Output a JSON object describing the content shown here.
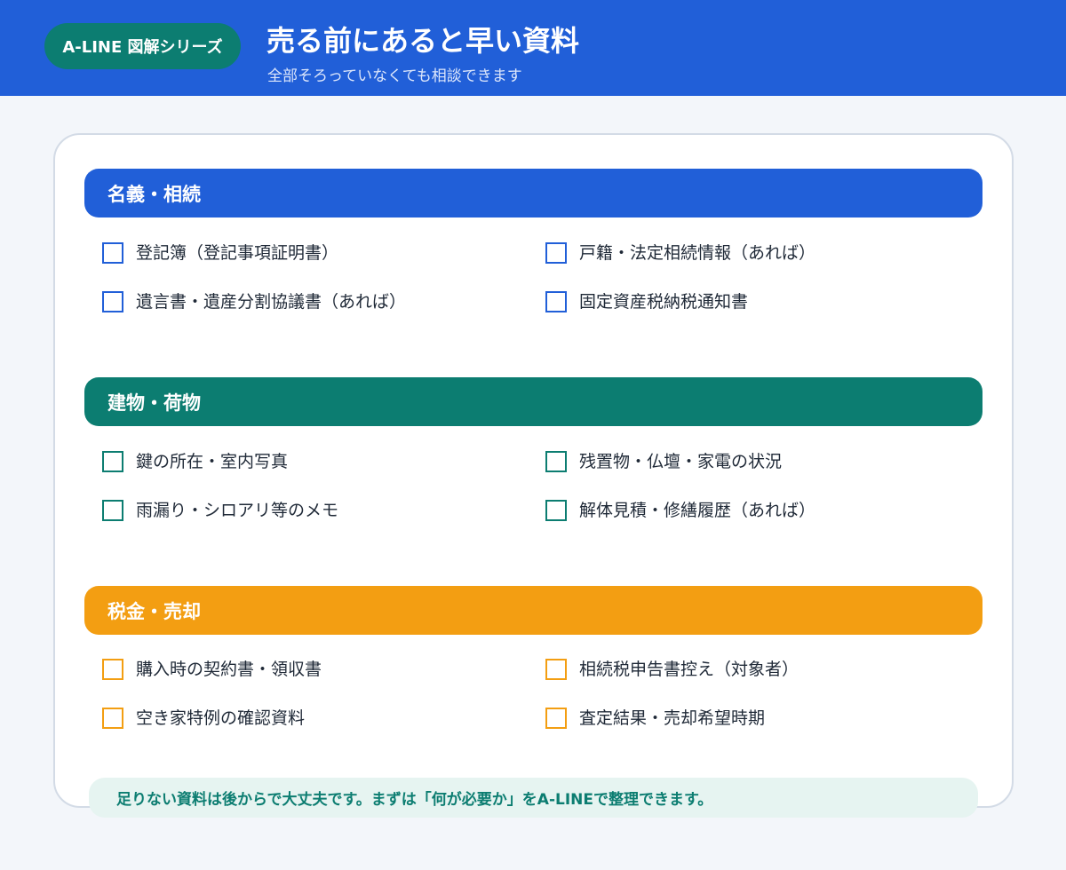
{
  "header": {
    "badge": "A-LINE 図解シリーズ",
    "title": "売る前にあると早い資料",
    "subtitle": "全部そろっていなくても相談できます"
  },
  "sections": [
    {
      "title": "名義・相続",
      "color": "#215fd8",
      "items": [
        "登記簿（登記事項証明書）",
        "戸籍・法定相続情報（あれば）",
        "遺言書・遺産分割協議書（あれば）",
        "固定資産税納税通知書"
      ]
    },
    {
      "title": "建物・荷物",
      "color": "#0c7d71",
      "items": [
        "鍵の所在・室内写真",
        "残置物・仏壇・家電の状況",
        "雨漏り・シロアリ等のメモ",
        "解体見積・修繕履歴（あれば）"
      ]
    },
    {
      "title": "税金・売却",
      "color": "#f39e12",
      "items": [
        "購入時の契約書・領収書",
        "相続税申告書控え（対象者）",
        "空き家特例の確認資料",
        "査定結果・売却希望時期"
      ]
    }
  ],
  "footer": {
    "note": "足りない資料は後からで大丈夫です。まずは「何が必要か」をA-LINEで整理できます。"
  }
}
